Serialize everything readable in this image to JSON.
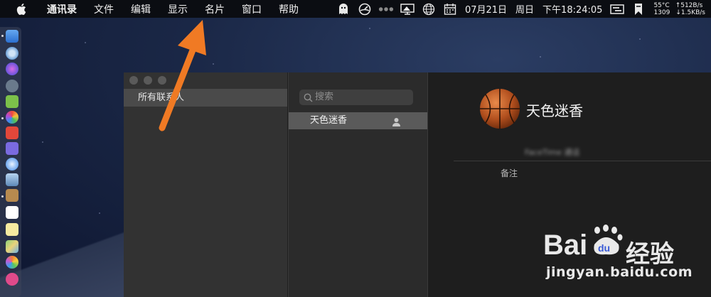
{
  "menubar": {
    "app_name": "通讯录",
    "items": [
      "文件",
      "编辑",
      "显示",
      "名片",
      "窗口",
      "帮助"
    ]
  },
  "status_bar": {
    "date": "07月21日",
    "weekday": "周日",
    "time": "下午18:24:05",
    "cpu_temp": "55°C",
    "fan_rpm": "1309",
    "net_up": "↑512B/s",
    "net_down": "↓1.5KB/s"
  },
  "sidebar": {
    "groups": [
      "所有联系人"
    ]
  },
  "contact_list": {
    "search_placeholder": "搜索",
    "contacts": [
      {
        "name": "天色迷香",
        "selected": true
      }
    ]
  },
  "detail": {
    "name": "天色迷香",
    "facetime_label": "FaceTime 通话",
    "note_label": "备注"
  },
  "watermark": {
    "brand": "Bai",
    "brand_suffix": "du",
    "cn": "经验",
    "url": "jingyan.baidu.com"
  },
  "colors": {
    "arrow": "#f07a24",
    "menubar_bg": "#0b0d12",
    "selected_row": "#5a5a5a"
  },
  "icons": [
    "apple-icon",
    "ghost-icon",
    "speedometer-icon",
    "dots-icon",
    "monitor-icon",
    "globe-icon",
    "calendar-icon",
    "cmd-icon",
    "bookmark-icon",
    "search-icon",
    "person-icon"
  ]
}
